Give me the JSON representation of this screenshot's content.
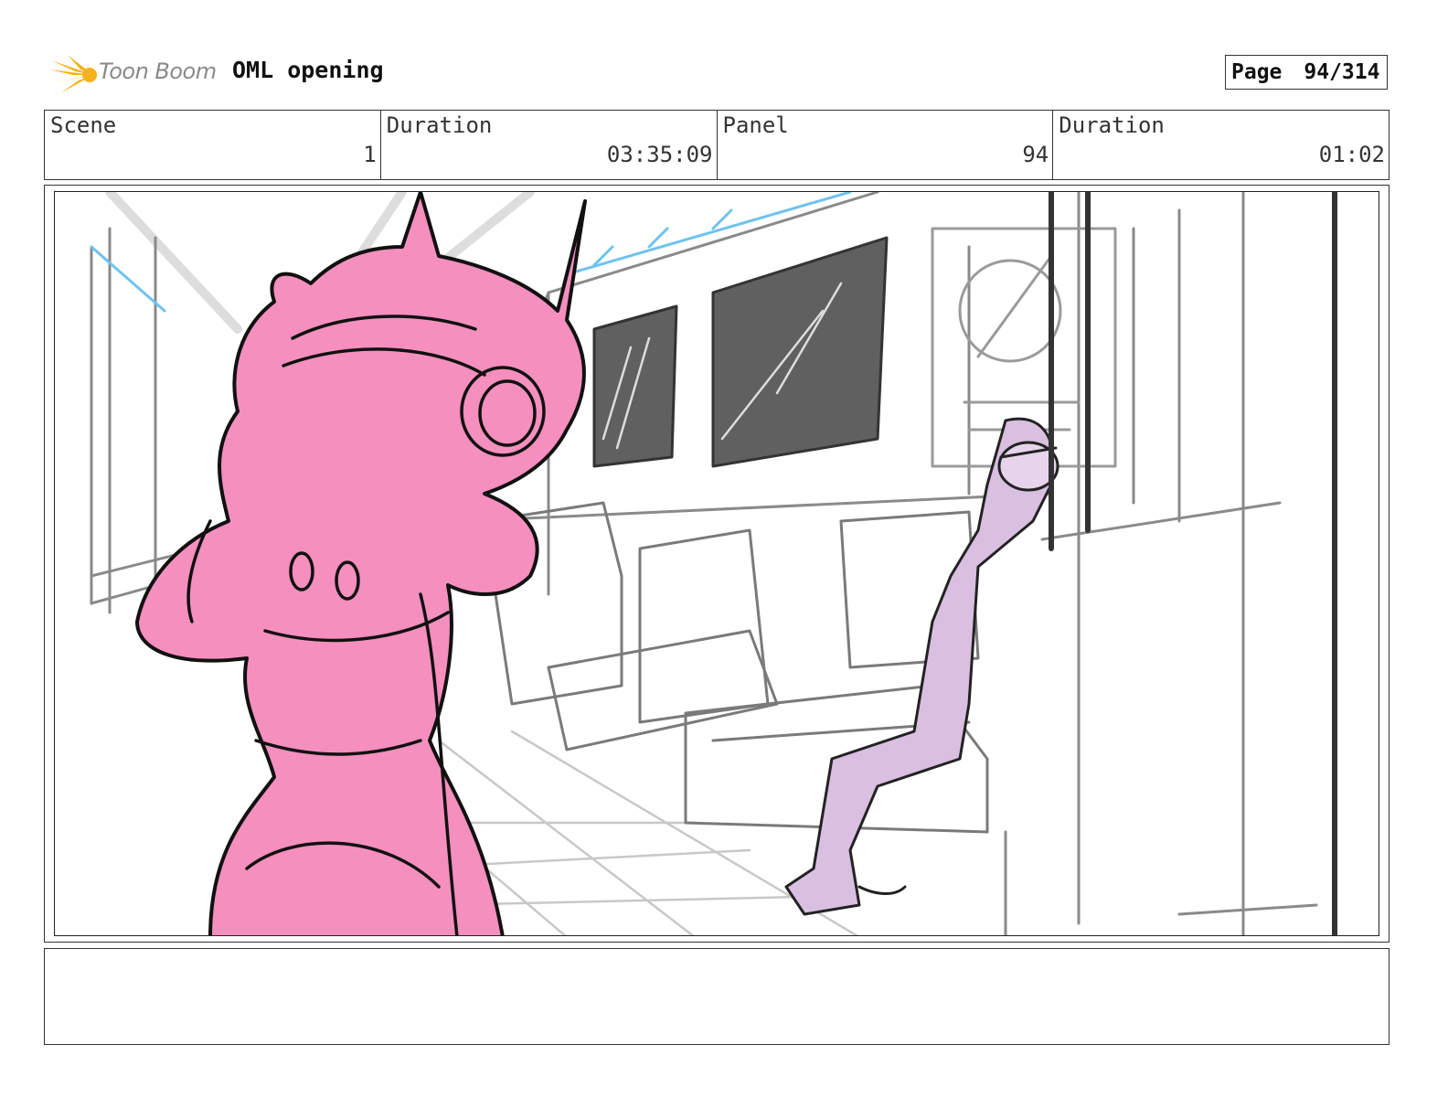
{
  "header": {
    "logo_text": "Toon Boom",
    "project_title": "OML opening",
    "page_label": "Page",
    "page_value": "94/314"
  },
  "info": {
    "scene_label": "Scene",
    "scene_value": "1",
    "duration_label": "Duration",
    "duration_value": "03:35:09",
    "panel_label": "Panel",
    "panel_value": "94",
    "panel_duration_label": "Duration",
    "panel_duration_value": "01:02"
  },
  "notes": {
    "text": ""
  },
  "colors": {
    "character_pink": "#f48fbe",
    "passenger_lavender": "#d9bfe0",
    "window_dark": "#606060",
    "handrail_blue": "#6ec3ef",
    "logo_orange": "#f5b21a"
  }
}
